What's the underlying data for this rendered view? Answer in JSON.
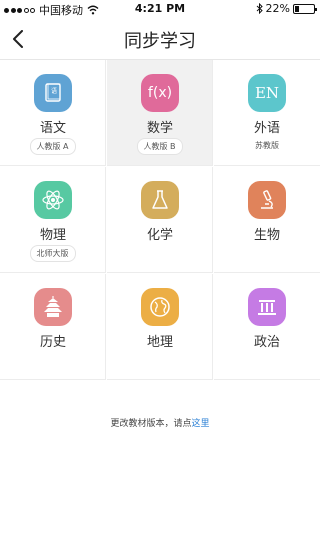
{
  "status": {
    "carrier": "中国移动",
    "time": "4:21 PM",
    "battery": "22%",
    "battery_level": 0.22
  },
  "nav": {
    "title": "同步学习"
  },
  "subjects": [
    {
      "label": "语文",
      "edition": "人教版 A",
      "icon": "book-icon",
      "color": "#5fa3d4"
    },
    {
      "label": "数学",
      "edition": "人教版 B",
      "icon": "fx-icon",
      "color": "#e06a9a",
      "glyph": "f(x)"
    },
    {
      "label": "外语",
      "edition": "苏教版",
      "icon": "en-icon",
      "color": "#5cc6cc",
      "glyph": "EN"
    },
    {
      "label": "物理",
      "edition": "北师大版",
      "icon": "atom-icon",
      "color": "#57c9a2"
    },
    {
      "label": "化学",
      "icon": "flask-icon",
      "color": "#d4ad5c"
    },
    {
      "label": "生物",
      "icon": "microscope-icon",
      "color": "#e0835b"
    },
    {
      "label": "历史",
      "icon": "pagoda-icon",
      "color": "#e58c8c"
    },
    {
      "label": "地理",
      "icon": "globe-icon",
      "color": "#ecae45"
    },
    {
      "label": "政治",
      "icon": "building-icon",
      "color": "#c57be4"
    }
  ],
  "footer": {
    "text": "更改教材版本，请点",
    "link": "这里"
  }
}
